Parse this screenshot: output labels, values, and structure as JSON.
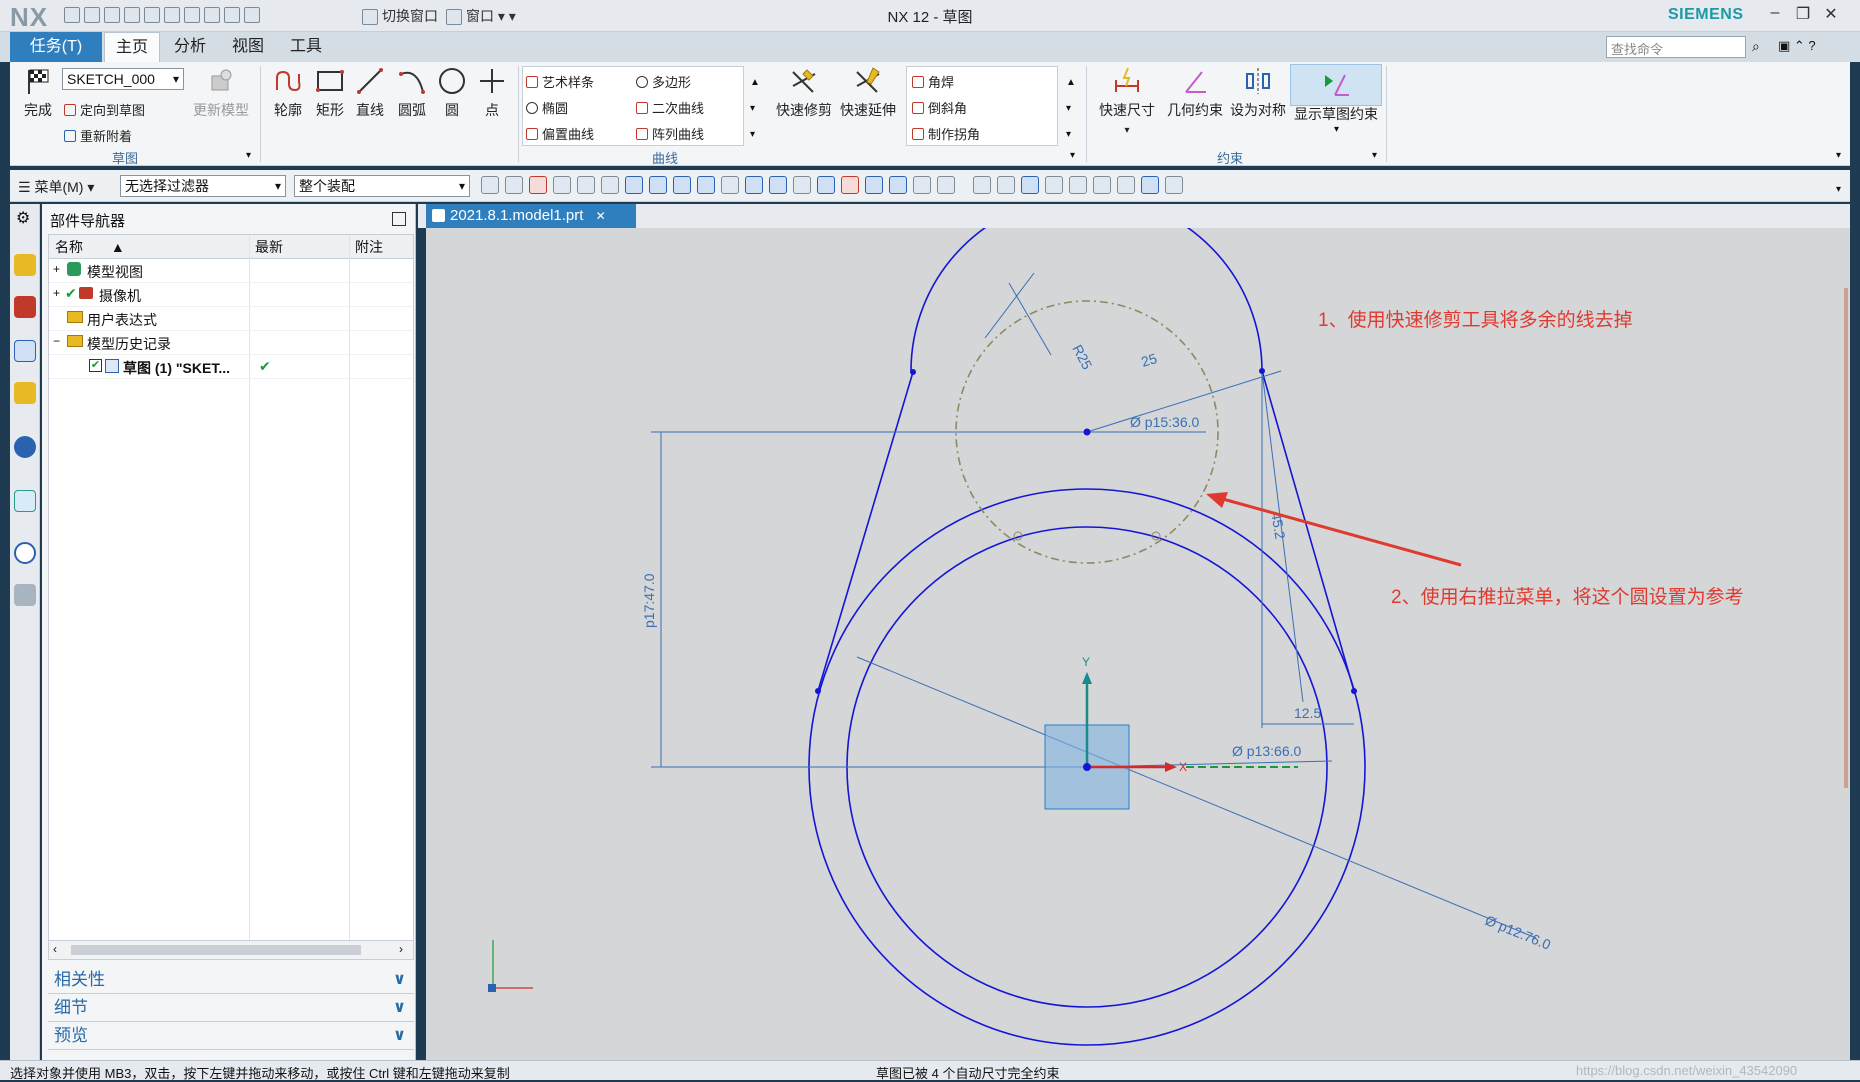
{
  "app": {
    "logo": "NX",
    "title": "NX 12 - 草图",
    "brand": "SIEMENS",
    "switch_window": "切换窗口",
    "window_menu": "窗口"
  },
  "tabs": [
    "任务(T)",
    "主页",
    "分析",
    "视图",
    "工具"
  ],
  "search": {
    "placeholder": "查找命令"
  },
  "ribbon": {
    "finish": "完成",
    "sketch_name": "SKETCH_000",
    "orient": "定向到草图",
    "reattach": "重新附着",
    "update_model": "更新模型",
    "group_sketch": "草图",
    "profile": "轮廓",
    "rectangle": "矩形",
    "line": "直线",
    "arc": "圆弧",
    "circle": "圆",
    "point": "点",
    "studio_spline": "艺术样条",
    "polygon": "多边形",
    "ellipse": "椭圆",
    "conic": "二次曲线",
    "offset_curve": "偏置曲线",
    "pattern_curve": "阵列曲线",
    "quick_trim": "快速修剪",
    "quick_extend": "快速延伸",
    "fillet": "角焊",
    "chamfer": "倒斜角",
    "make_corner": "制作拐角",
    "group_curve": "曲线",
    "rapid_dim": "快速尺寸",
    "geo_constraint": "几何约束",
    "make_symmetric": "设为对称",
    "show_constraints": "显示草图约束",
    "group_constraint": "约束"
  },
  "toolbar2": {
    "menu": "菜单(M)",
    "filter": "无选择过滤器",
    "scope": "整个装配"
  },
  "navigator": {
    "title": "部件导航器",
    "columns": [
      "名称",
      "最新",
      "附注"
    ],
    "rows": [
      {
        "label": "模型视图",
        "latest": ""
      },
      {
        "label": "摄像机",
        "latest": ""
      },
      {
        "label": "用户表达式",
        "latest": ""
      },
      {
        "label": "模型历史记录",
        "latest": ""
      },
      {
        "label": "草图 (1) \"SKET...",
        "latest": "✔"
      }
    ],
    "panels": [
      "相关性",
      "细节",
      "预览"
    ]
  },
  "document_tab": "2021.8.1.model1.prt",
  "dims": {
    "r25": "R25",
    "d25": "25",
    "p15": "Ø p15:36.0",
    "p13": "Ø p13:66.0",
    "p12": "Ø p12:76.0",
    "p17": "p17:47.0",
    "d452": "45.2",
    "d125": "12.5"
  },
  "axis": {
    "x": "X",
    "y": "Y"
  },
  "annotations": [
    "1、使用快速修剪工具将多余的线去掉",
    "2、使用右推拉菜单，将这个圆设置为参考"
  ],
  "status": {
    "left": "选择对象并使用 MB3，双击，按下左键并拖动来移动，或按住 Ctrl 键和左键拖动来复制",
    "center": "草图已被 4 个自动尺寸完全约束",
    "watermark": "https://blog.csdn.net/weixin_43542090"
  },
  "colors": {
    "accent": "#2f7fbf",
    "sketch": "#1515d6",
    "dim": "#3b6fb4",
    "reference": "#8c8a63",
    "annotation": "#e03a2f"
  }
}
